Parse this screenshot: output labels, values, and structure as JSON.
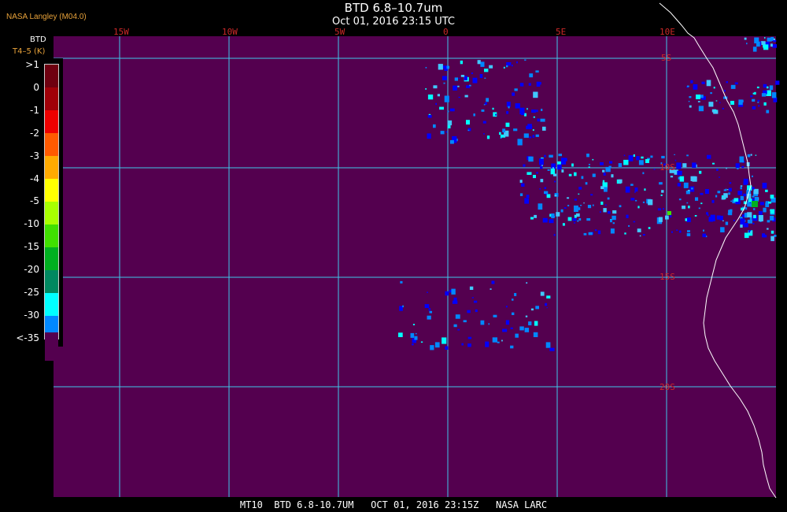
{
  "header": {
    "org": "NASA Langley (M04.0)",
    "title": "BTD 6.8–10.7um",
    "datetime": "Oct 01, 2016 23:15 UTC"
  },
  "legend": {
    "title": "BTD",
    "subtitle": "T4–5 (K)",
    "entries": [
      {
        "label": ">1",
        "color": "#6e0010"
      },
      {
        "label": "0",
        "color": "#a00008"
      },
      {
        "label": "-1",
        "color": "#ee0000"
      },
      {
        "label": "-2",
        "color": "#ff5a00"
      },
      {
        "label": "-3",
        "color": "#ffaa00"
      },
      {
        "label": "-4",
        "color": "#ffff00"
      },
      {
        "label": "-5",
        "color": "#a8ff00"
      },
      {
        "label": "-10",
        "color": "#40e000"
      },
      {
        "label": "-15",
        "color": "#00b020"
      },
      {
        "label": "-20",
        "color": "#008860"
      },
      {
        "label": "-25",
        "color": "#00ffff"
      },
      {
        "label": "-30",
        "color": "#0088ff"
      },
      {
        "label": "<-35",
        "color": "#0000ff"
      }
    ],
    "bottom_color": "#54004f"
  },
  "map": {
    "background": "#54004f",
    "grid_color": "#40c8e8",
    "coast_color": "#ffffff",
    "lon_labels": [
      "15W",
      "10W",
      "5W",
      "0",
      "5E",
      "10E"
    ],
    "lat_labels": [
      "5S",
      "10S",
      "15S",
      "20S"
    ]
  },
  "footer": {
    "text": "MT10  BTD 6.8-10.7UM   OCT 01, 2016 23:15Z   NASA LARC"
  }
}
